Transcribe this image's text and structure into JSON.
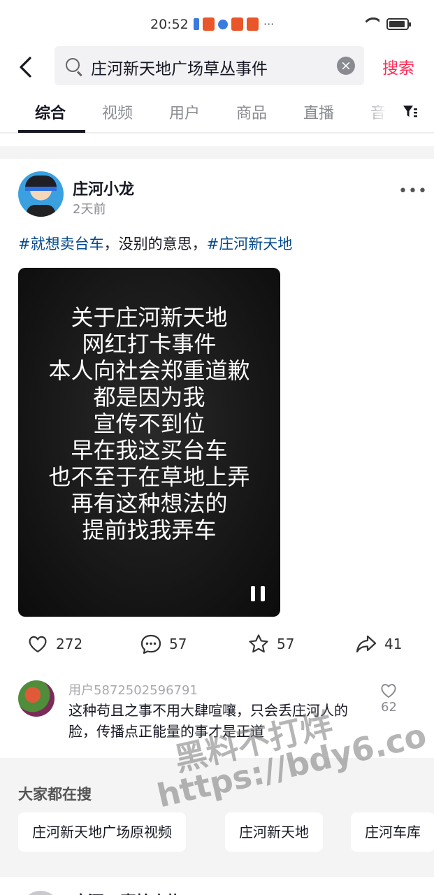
{
  "status_bar": {
    "time": "20:52",
    "more": "···"
  },
  "search": {
    "query": "庄河新天地广场草丛事件",
    "button": "搜索",
    "clear": "×"
  },
  "tabs": [
    {
      "label": "综合",
      "active": true
    },
    {
      "label": "视频"
    },
    {
      "label": "用户"
    },
    {
      "label": "商品"
    },
    {
      "label": "直播"
    },
    {
      "label": "音"
    }
  ],
  "post": {
    "author": "庄河小龙",
    "time": "2天前",
    "text": {
      "tag1": "#就想卖台车",
      "middle": "，没别的意思，",
      "tag2": "#庄河新天地"
    },
    "video_lines": [
      "关于庄河新天地",
      "网红打卡事件",
      "本人向社会郑重道歉",
      "都是因为我",
      "宣传不到位",
      "早在我这买台车",
      "也不至于在草地上弄",
      "再有这种想法的",
      "提前找我弄车"
    ],
    "likes": "272",
    "comments": "57",
    "favorites": "57",
    "shares": "41"
  },
  "comment": {
    "user": "用户5872502596791",
    "text": "这种苟且之事不用大肆喧嚷，只会丢庄河人的脸，传播点正能量的事才是正道",
    "likes": "62"
  },
  "trending": {
    "title": "大家都在搜",
    "chips": [
      "庄河新天地广场原视频",
      "庄河新天地",
      "庄河车库"
    ]
  },
  "next_item": {
    "name": "庄河 - 壹拾火炸"
  },
  "watermark": {
    "line1": "黑料不打烊",
    "line2": "https://bdy6.co"
  }
}
